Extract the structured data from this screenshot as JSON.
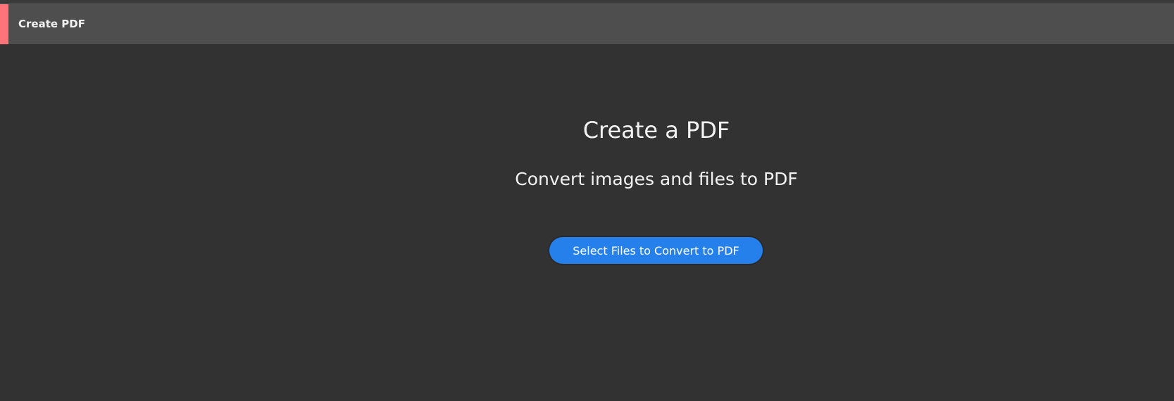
{
  "header": {
    "title": "Create PDF",
    "accent_color": "#ff7479"
  },
  "main": {
    "title": "Create a PDF",
    "subtitle": "Convert images and files to PDF",
    "select_button_label": "Select Files to Convert to PDF",
    "button_color": "#2680eb"
  }
}
